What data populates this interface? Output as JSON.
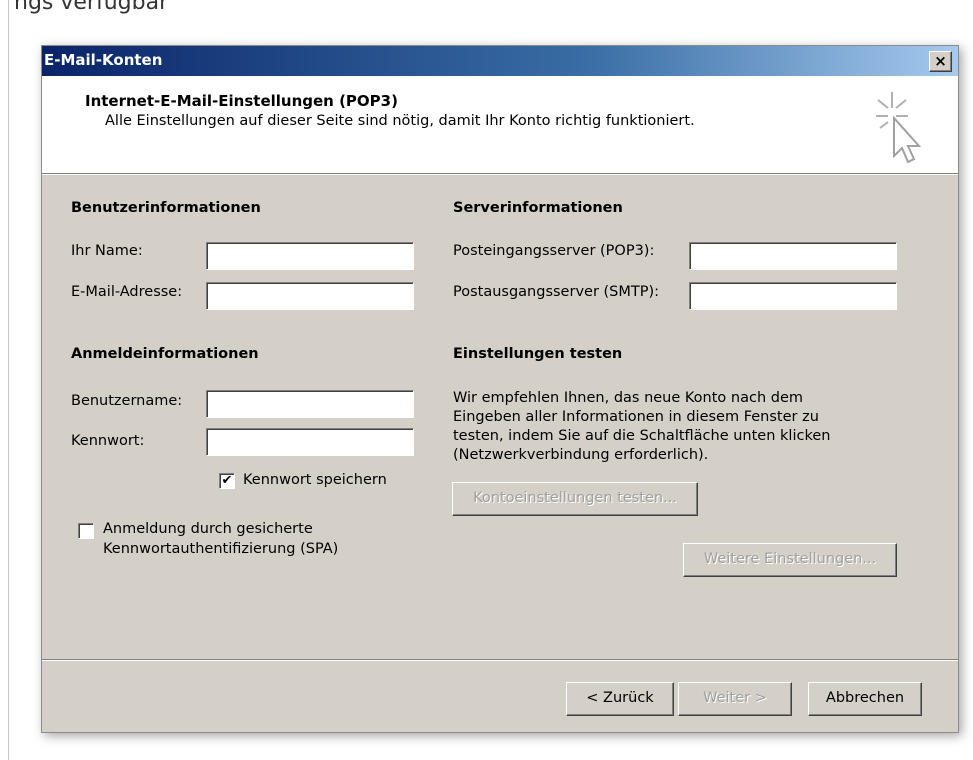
{
  "page_top_text": "ngs verfügbar",
  "window": {
    "title": "E-Mail-Konten",
    "close_label": "×"
  },
  "header": {
    "title": "Internet-E-Mail-Einstellungen (POP3)",
    "subtitle": "Alle Einstellungen auf dieser Seite sind nötig, damit Ihr Konto richtig funktioniert.",
    "icon": "wizard-cursor-icon"
  },
  "user_info": {
    "heading": "Benutzerinformationen",
    "name_label": "Ihr Name:",
    "name_value": "",
    "email_label": "E-Mail-Adresse:",
    "email_value": ""
  },
  "server_info": {
    "heading": "Serverinformationen",
    "incoming_label": "Posteingangsserver (POP3):",
    "incoming_value": "",
    "outgoing_label": "Postausgangsserver (SMTP):",
    "outgoing_value": ""
  },
  "login_info": {
    "heading": "Anmeldeinformationen",
    "username_label": "Benutzername:",
    "username_value": "",
    "password_label": "Kennwort:",
    "password_value": "",
    "save_password_label": "Kennwort speichern",
    "save_password_checked": true,
    "spa_label_line1": "Anmeldung durch gesicherte",
    "spa_label_line2": "Kennwortauthentifizierung (SPA)",
    "spa_checked": false
  },
  "test_settings": {
    "heading": "Einstellungen testen",
    "description": [
      "Wir empfehlen Ihnen, das neue Konto nach dem",
      "Eingeben aller Informationen in diesem Fenster zu",
      "testen, indem Sie auf die Schaltfläche unten klicken",
      "(Netzwerkverbindung erforderlich)."
    ],
    "test_button": "Kontoeinstellungen testen...",
    "more_settings_button": "Weitere Einstellungen..."
  },
  "footer": {
    "back_button": "< Zurück",
    "next_button": "Weiter >",
    "cancel_button": "Abbrechen"
  }
}
